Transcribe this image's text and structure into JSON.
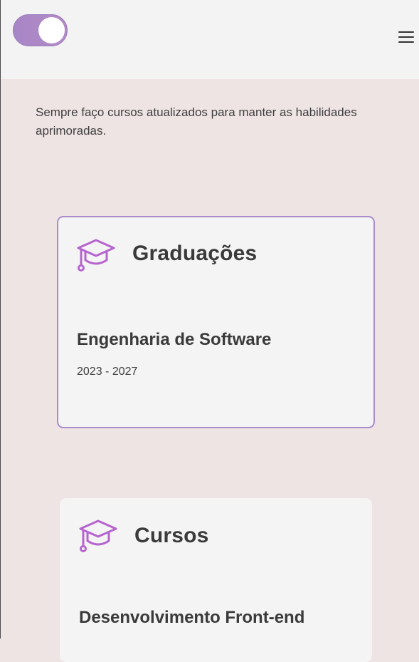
{
  "header": {
    "theme_toggle": {
      "state": "on"
    },
    "menu_icon": "hamburger-menu-icon"
  },
  "intro": {
    "text": "Sempre faço cursos atualizados para manter as habilidades aprimoradas."
  },
  "cards": [
    {
      "icon": "graduation-cap-icon",
      "title": "Graduações",
      "item_title": "Engenharia de Software",
      "item_date": "2023 - 2027"
    },
    {
      "icon": "graduation-cap-icon",
      "title": "Cursos",
      "item_title": "Desenvolvimento Front-end"
    }
  ],
  "colors": {
    "accent": "#a98ccc",
    "icon": "#b564cf",
    "background": "#efe4e4",
    "header": "#f4f3f3",
    "card": "#f5f4f4"
  }
}
